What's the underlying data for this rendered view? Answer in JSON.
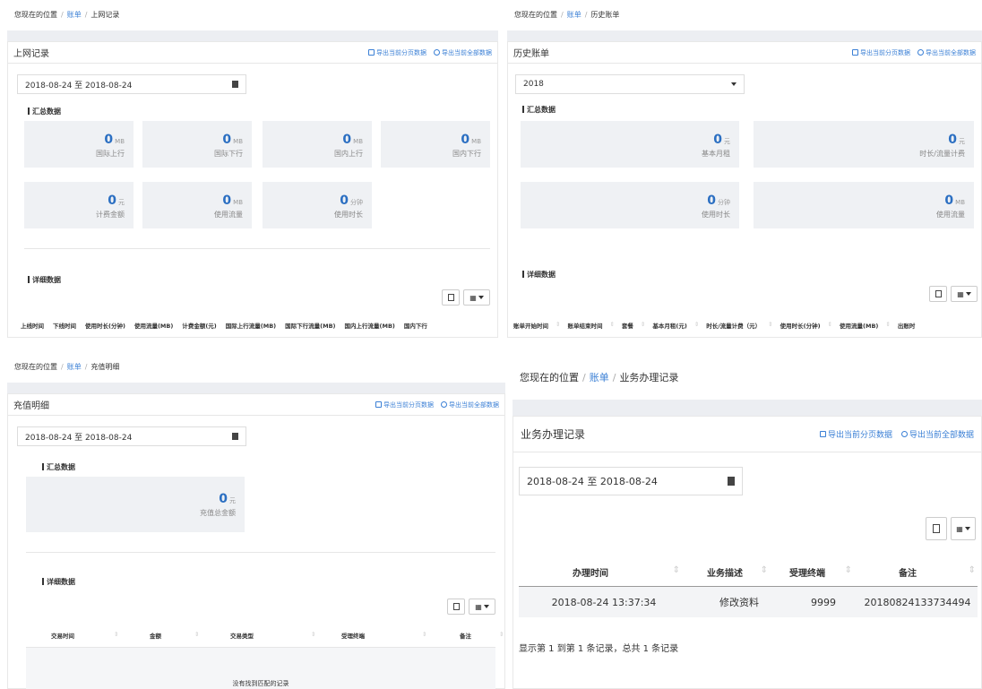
{
  "common": {
    "location_prefix": "您现在的位置",
    "bill": "账单",
    "export_page": "导出当前分页数据",
    "export_all": "导出当前全部数据",
    "summary": "汇总数据",
    "detail": "详细数据",
    "date_range": "2018-08-24 至 2018-08-24"
  },
  "p1": {
    "crumb": "上网记录",
    "title": "上网记录",
    "stats": [
      {
        "value": "0",
        "unit": "MB",
        "label": "国际上行"
      },
      {
        "value": "0",
        "unit": "MB",
        "label": "国际下行"
      },
      {
        "value": "0",
        "unit": "MB",
        "label": "国内上行"
      },
      {
        "value": "0",
        "unit": "MB",
        "label": "国内下行"
      },
      {
        "value": "0",
        "unit": "元",
        "label": "计费金额"
      },
      {
        "value": "0",
        "unit": "MB",
        "label": "使用流量"
      },
      {
        "value": "0",
        "unit": "分钟",
        "label": "使用时长"
      }
    ],
    "columns": [
      "上线时间",
      "下线时间",
      "使用时长(分钟)",
      "使用流量(MB)",
      "计费金额(元)",
      "国际上行流量(MB)",
      "国际下行流量(MB)",
      "国内上行流量(MB)",
      "国内下行"
    ]
  },
  "p2": {
    "crumb": "历史账单",
    "title": "历史账单",
    "year": "2018",
    "stats": [
      {
        "value": "0",
        "unit": "元",
        "label": "基本月租"
      },
      {
        "value": "0",
        "unit": "元",
        "label": "时长/流量计费"
      },
      {
        "value": "0",
        "unit": "分钟",
        "label": "使用时长"
      },
      {
        "value": "0",
        "unit": "MB",
        "label": "使用流量"
      }
    ],
    "columns": [
      "账单开始时间",
      "账单结束时间",
      "套餐",
      "基本月租(元)",
      "时长/流量计费（元）",
      "使用时长(分钟)",
      "使用流量(MB)",
      "出账时"
    ]
  },
  "p3": {
    "crumb": "充值明细",
    "title": "充值明细",
    "stat": {
      "value": "0",
      "unit": "元",
      "label": "充值总金额"
    },
    "columns": [
      "交易时间",
      "金额",
      "交易类型",
      "受理终端",
      "备注"
    ],
    "empty": "没有找到匹配的记录"
  },
  "p4": {
    "crumb": "业务办理记录",
    "title": "业务办理记录",
    "columns": [
      "办理时间",
      "业务描述",
      "受理终端",
      "备注"
    ],
    "rows": [
      [
        "2018-08-24 13:37:34",
        "修改资料",
        "9999",
        "20180824133734494"
      ]
    ],
    "footer": "显示第 1 到第 1 条记录，总共 1 条记录"
  }
}
